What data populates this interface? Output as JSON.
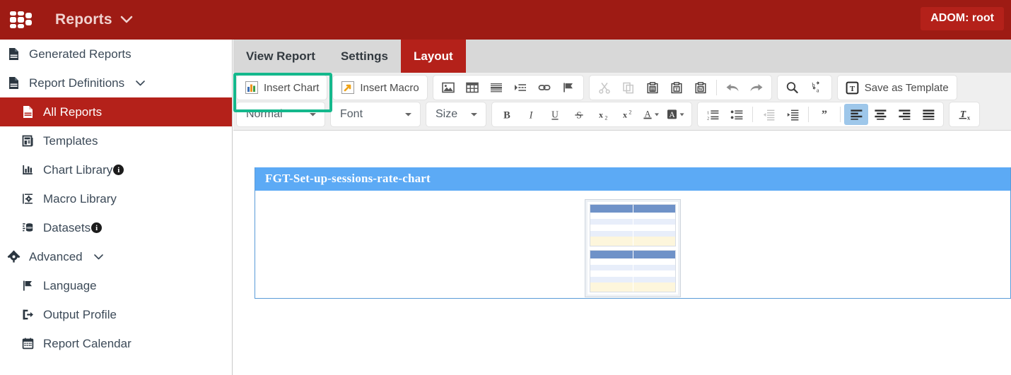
{
  "topbar": {
    "logo_icon": "fortinet-grid-logo-icon",
    "app_menu_label": "Reports",
    "app_menu_caret_icon": "chevron-down-icon",
    "adom_badge": "ADOM: root",
    "bar_color": "#9e1b14",
    "badge_color": "#b4211a"
  },
  "sidebar": {
    "items": [
      {
        "label": "Generated Reports",
        "icon": "report-document-icon",
        "level": 0,
        "active": false,
        "caret": false,
        "info": false
      },
      {
        "label": "Report Definitions",
        "icon": "report-document-icon",
        "level": 0,
        "active": false,
        "caret": true,
        "info": false
      },
      {
        "label": "All Reports",
        "icon": "report-document-icon",
        "level": 1,
        "active": true,
        "caret": false,
        "info": false
      },
      {
        "label": "Templates",
        "icon": "template-icon",
        "level": 1,
        "active": false,
        "caret": false,
        "info": false
      },
      {
        "label": "Chart Library",
        "icon": "bar-chart-icon",
        "level": 1,
        "active": false,
        "caret": false,
        "info": true
      },
      {
        "label": "Macro Library",
        "icon": "macro-gear-icon",
        "level": 1,
        "active": false,
        "caret": false,
        "info": false
      },
      {
        "label": "Datasets",
        "icon": "datasets-icon",
        "level": 1,
        "active": false,
        "caret": false,
        "info": true
      },
      {
        "label": "Advanced",
        "icon": "gear-icon",
        "level": 0,
        "active": false,
        "caret": true,
        "info": false
      },
      {
        "label": "Language",
        "icon": "flag-icon",
        "level": 1,
        "active": false,
        "caret": false,
        "info": false
      },
      {
        "label": "Output Profile",
        "icon": "output-profile-icon",
        "level": 1,
        "active": false,
        "caret": false,
        "info": false
      },
      {
        "label": "Report Calendar",
        "icon": "calendar-icon",
        "level": 1,
        "active": false,
        "caret": false,
        "info": false
      }
    ],
    "active_color": "#b4211a"
  },
  "tabs": [
    {
      "label": "View Report",
      "active": false
    },
    {
      "label": "Settings",
      "active": false
    },
    {
      "label": "Layout",
      "active": true
    }
  ],
  "toolbar": {
    "insert_chart_label": "Insert Chart",
    "insert_chart_icon": "bar-chart-color-icon",
    "insert_chart_highlight_color": "#14b88c",
    "insert_macro_label": "Insert Macro",
    "insert_macro_icon": "macro-arrow-icon",
    "insert_group_icons": [
      {
        "name": "image-icon"
      },
      {
        "name": "table-icon"
      },
      {
        "name": "horizontal-rule-icon"
      },
      {
        "name": "page-break-icon"
      },
      {
        "name": "link-icon"
      },
      {
        "name": "anchor-flag-icon"
      }
    ],
    "clipboard_icons": [
      {
        "name": "cut-icon",
        "disabled": true
      },
      {
        "name": "copy-icon",
        "disabled": true
      },
      {
        "name": "paste-icon",
        "disabled": false
      },
      {
        "name": "paste-as-plain-text-icon",
        "disabled": false
      },
      {
        "name": "paste-from-word-icon",
        "disabled": false
      },
      {
        "name": "undo-icon",
        "disabled": false
      },
      {
        "name": "redo-icon",
        "disabled": false
      }
    ],
    "find_icons": [
      {
        "name": "find-icon"
      },
      {
        "name": "replace-icon"
      }
    ],
    "save_as_template_label": "Save as Template",
    "save_as_template_icon": "templates-t-icon",
    "selects": [
      {
        "name": "paragraph-format-select",
        "value": "Normal"
      },
      {
        "name": "font-family-select",
        "value": "Font"
      },
      {
        "name": "font-size-select",
        "value": "Size"
      }
    ],
    "text_style_icons": [
      {
        "name": "bold-icon",
        "glyph": "B"
      },
      {
        "name": "italic-icon",
        "glyph": "I"
      },
      {
        "name": "underline-icon",
        "glyph": "U"
      },
      {
        "name": "strikethrough-icon",
        "glyph": "S"
      },
      {
        "name": "subscript-icon",
        "glyph": "x₂"
      },
      {
        "name": "superscript-icon",
        "glyph": "x²"
      },
      {
        "name": "text-color-icon",
        "glyph": "A"
      },
      {
        "name": "background-color-icon",
        "glyph": "A"
      }
    ],
    "paragraph_icons": [
      {
        "name": "numbered-list-icon",
        "active": false,
        "disabled": false
      },
      {
        "name": "bulleted-list-icon",
        "active": false,
        "disabled": false
      },
      {
        "name": "decrease-indent-icon",
        "active": false,
        "disabled": true
      },
      {
        "name": "increase-indent-icon",
        "active": false,
        "disabled": false
      },
      {
        "name": "blockquote-icon",
        "active": false,
        "disabled": false
      },
      {
        "name": "align-left-icon",
        "active": true,
        "disabled": false
      },
      {
        "name": "align-center-icon",
        "active": false,
        "disabled": false
      },
      {
        "name": "align-right-icon",
        "active": false,
        "disabled": false
      },
      {
        "name": "justify-icon",
        "active": false,
        "disabled": false
      }
    ],
    "remove_format_icon": "remove-format-icon"
  },
  "document": {
    "banner_title": "FGT-Set-up-sessions-rate-chart",
    "banner_color": "#5caaf5",
    "border_color": "#5a9bd8",
    "placeholder_icon": "broken-image-placeholder-icon",
    "placeholder_header_color": "#6f92c8",
    "placeholder_alt_row_color": "#e8eefa",
    "placeholder_total_row_color": "#fdf6dc"
  }
}
